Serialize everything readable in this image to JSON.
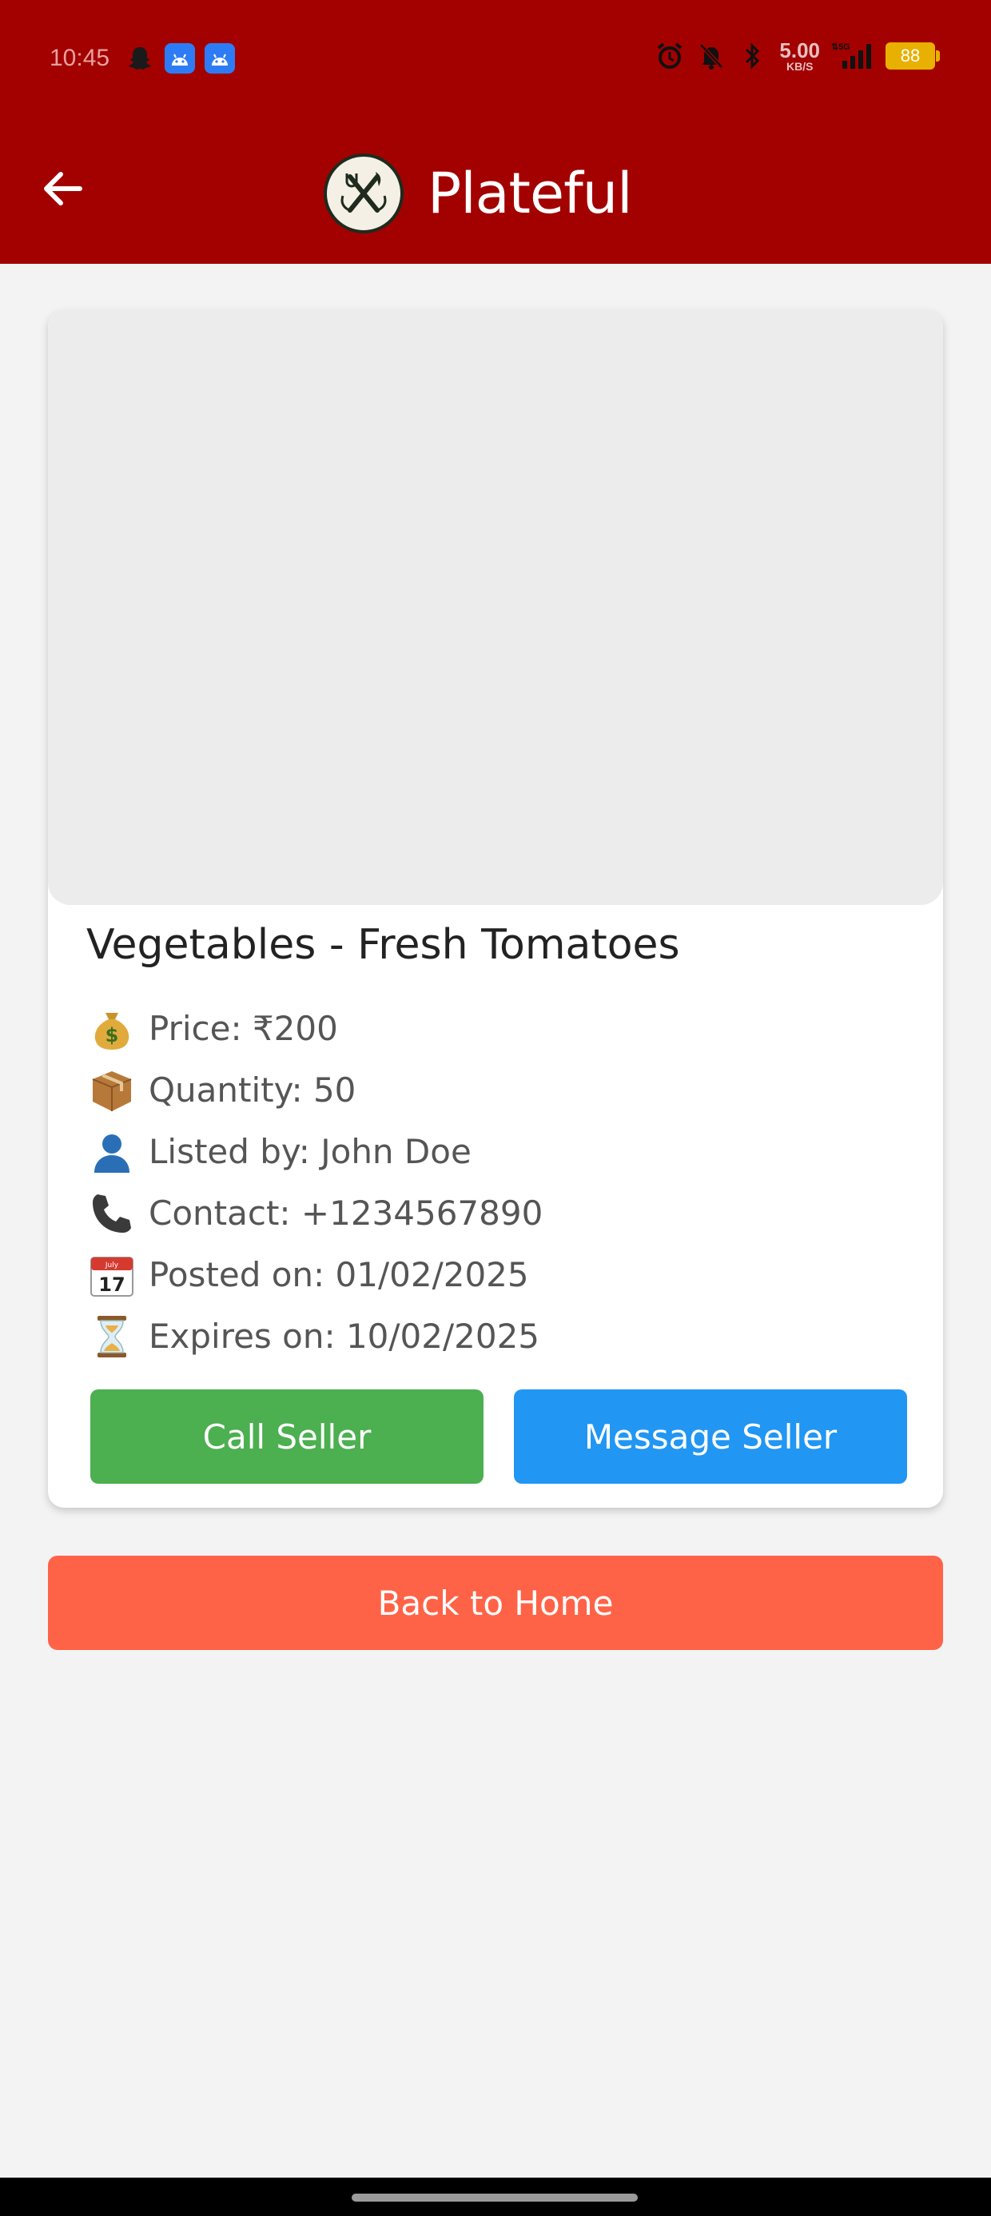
{
  "status_bar": {
    "time": "10:45",
    "net_speed_value": "5.00",
    "net_speed_unit": "KB/S",
    "signal_label": "5G",
    "battery": "88"
  },
  "header": {
    "title": "Plateful"
  },
  "listing": {
    "title": "Vegetables - Fresh Tomatoes",
    "details": [
      {
        "icon": "money-bag-icon",
        "text": "Price: ₹200"
      },
      {
        "icon": "package-icon",
        "text": "Quantity: 50"
      },
      {
        "icon": "person-icon",
        "text": "Listed by: John Doe"
      },
      {
        "icon": "telephone-icon",
        "text": "Contact: +1234567890"
      },
      {
        "icon": "calendar-icon",
        "text": "Posted on: 01/02/2025"
      },
      {
        "icon": "hourglass-icon",
        "text": "Expires on: 10/02/2025"
      }
    ],
    "calendar_month": "July",
    "calendar_day": "17",
    "call_label": "Call Seller",
    "message_label": "Message Seller"
  },
  "footer": {
    "back_home_label": "Back to Home"
  },
  "colors": {
    "header_bg": "#a30000",
    "call_button": "#4caf50",
    "message_button": "#2196f3",
    "home_button": "#ff6347"
  }
}
